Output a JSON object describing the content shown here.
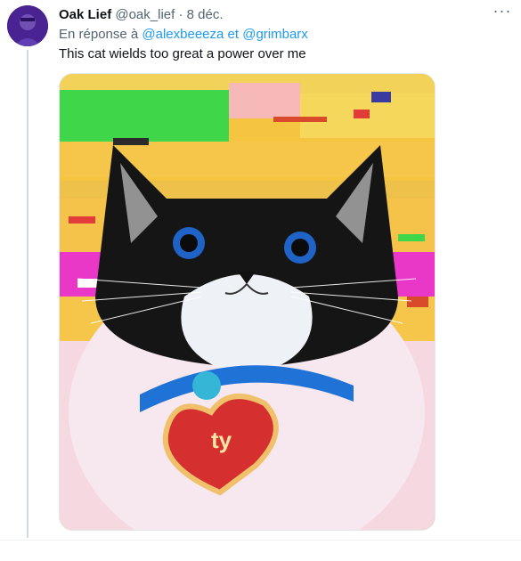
{
  "tweet": {
    "author_name": "Oak Lief",
    "author_handle": "@oak_lief",
    "separator": "·",
    "date": "8 déc.",
    "reply_prefix": "En réponse à",
    "mentions": [
      "@alexbeeeza",
      "@grimbarx"
    ],
    "mention_joiner": "et",
    "text": "This cat wields too great a power over me",
    "more_icon": "more-horizontal-icon"
  },
  "media": {
    "image_subject": "",
    "tag_text": "ty"
  },
  "colors": {
    "link": "#1d9bf0",
    "muted": "#536471",
    "text": "#0f1419"
  }
}
